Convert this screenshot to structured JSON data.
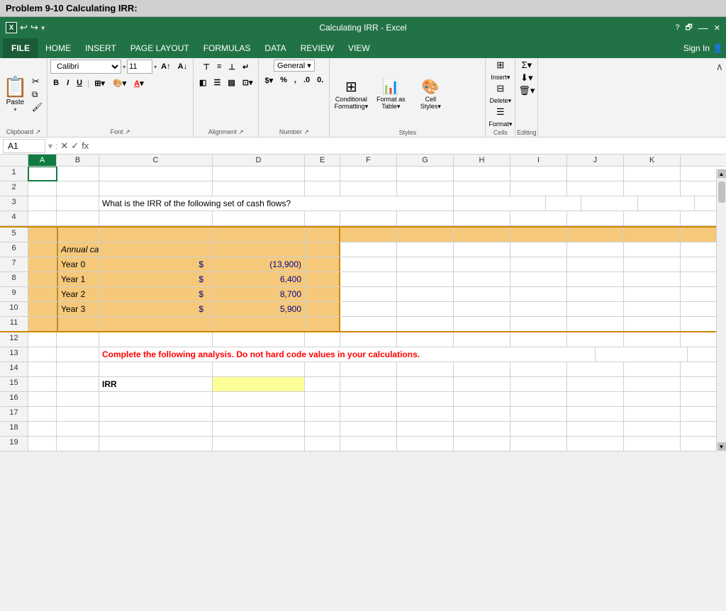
{
  "titleBar": {
    "title": "Calculating IRR - Excel",
    "helpBtn": "?",
    "restoreBtn": "🗗",
    "minimizeBtn": "—",
    "closeBtn": "✕"
  },
  "pageTitle": "Problem 9-10 Calculating IRR:",
  "menuBar": {
    "file": "FILE",
    "items": [
      "HOME",
      "INSERT",
      "PAGE LAYOUT",
      "FORMULAS",
      "DATA",
      "REVIEW",
      "VIEW"
    ],
    "signIn": "Sign In"
  },
  "toolbar": {
    "clipboard": {
      "label": "Clipboard",
      "pasteLabel": "Paste"
    },
    "font": {
      "label": "Font",
      "fontName": "Calibri",
      "fontSize": "11",
      "boldLabel": "B",
      "italicLabel": "I",
      "underlineLabel": "U"
    },
    "alignment": {
      "label": "Alignment",
      "buttonLabel": "Alignment"
    },
    "number": {
      "label": "Number",
      "buttonLabel": "Number"
    },
    "styles": {
      "label": "Styles",
      "conditionalFormatting": "Conditional Formatting",
      "formatAsTable": "Format as Table",
      "cellStyles": "Cell Styles"
    },
    "cells": {
      "label": "Cells",
      "buttonLabel": "Cells"
    },
    "editing": {
      "label": "Editing",
      "buttonLabel": "Editing"
    }
  },
  "formulaBar": {
    "cellRef": "A1",
    "formula": ""
  },
  "columns": [
    "A",
    "B",
    "C",
    "D",
    "E",
    "F",
    "G",
    "H",
    "I",
    "J",
    "K"
  ],
  "rows": [
    1,
    2,
    3,
    4,
    5,
    6,
    7,
    8,
    9,
    10,
    11,
    12,
    13,
    14,
    15,
    16,
    17,
    18,
    19
  ],
  "spreadsheet": {
    "questionText": "What is the IRR of the following set of cash flows?",
    "cashFlows": {
      "heading": "Annual cash flows:",
      "rows": [
        {
          "label": "Year 0",
          "dollar": "$",
          "value": "(13,900)"
        },
        {
          "label": "Year 1",
          "dollar": "$",
          "value": "6,400"
        },
        {
          "label": "Year 2",
          "dollar": "$",
          "value": "8,700"
        },
        {
          "label": "Year 3",
          "dollar": "$",
          "value": "5,900"
        }
      ]
    },
    "warningText": "Complete the following analysis. Do not hard code values in your calculations.",
    "irrLabel": "IRR"
  },
  "colors": {
    "excelGreen": "#217346",
    "cashBoxBg": "#f5c87a",
    "cashBoxBorder": "#cc8800",
    "irrHighlight": "#ffff99",
    "warningRed": "#cc0000",
    "dollarBlue": "#00008b",
    "selectedCell": "#107c41"
  }
}
